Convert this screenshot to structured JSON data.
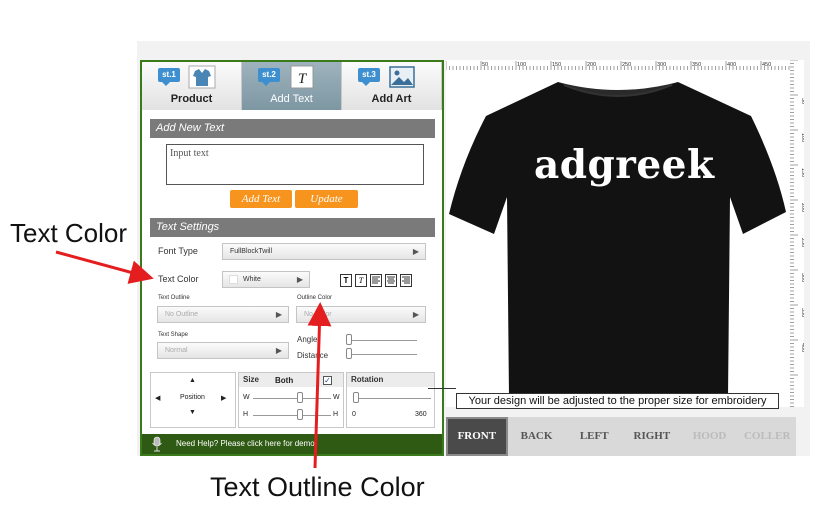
{
  "annotations": {
    "text_color_label": "Text Color",
    "outline_color_label": "Text Outline Color"
  },
  "steps": [
    {
      "badge": "st.1",
      "label": "Product",
      "icon": "shirt-icon"
    },
    {
      "badge": "st.2",
      "label": "Add Text",
      "icon": "text-icon",
      "active": true
    },
    {
      "badge": "st.3",
      "label": "Add Art",
      "icon": "picture-icon"
    }
  ],
  "add_text": {
    "header": "Add New Text",
    "input_value": "Input text",
    "add_button": "Add Text",
    "update_button": "Update"
  },
  "settings": {
    "header": "Text Settings",
    "font_type_label": "Font Type",
    "font_type_value": "FullBlockTwill",
    "text_color_label": "Text Color",
    "text_color_value": "White",
    "format_buttons": [
      "T",
      "T"
    ],
    "text_outline_label": "Text Outline",
    "text_outline_value": "No Outline",
    "outline_color_label": "Outline Color",
    "outline_color_value": "No Color",
    "text_shape_label": "Text Shape",
    "text_shape_value": "Normal",
    "angle_label": "Angle",
    "distance_label": "Distance"
  },
  "position": {
    "label": "Position",
    "up": "▲",
    "down": "▼",
    "left": "◀",
    "right": "▶"
  },
  "size": {
    "header": "Size",
    "both_label": "Both",
    "both_checked": true,
    "w_label": "W",
    "h_label": "H"
  },
  "rotation": {
    "header": "Rotation",
    "min": "0",
    "max": "360"
  },
  "help": {
    "text": "Need Help? Please click here for demo."
  },
  "canvas": {
    "design_text": "adgreek",
    "shirt_color": "#121212",
    "notice": "Your design will be adjusted to the proper size for embroidery",
    "ruler_top": [
      "50",
      "100",
      "150",
      "200",
      "250",
      "300",
      "350",
      "400",
      "450"
    ],
    "ruler_right": [
      "50",
      "100",
      "150",
      "200",
      "250",
      "300",
      "350",
      "400"
    ]
  },
  "views": [
    {
      "label": "FRONT",
      "active": true
    },
    {
      "label": "BACK"
    },
    {
      "label": "LEFT"
    },
    {
      "label": "RIGHT"
    },
    {
      "label": "HOOD",
      "disabled": true
    },
    {
      "label": "COLLER",
      "disabled": true
    }
  ],
  "colors": {
    "panel_border": "#3a7a1a",
    "orange": "#f7941d",
    "section_bar": "#7a7a7a",
    "help_bar": "#2f5a13",
    "arrow": "#e41e1e"
  }
}
